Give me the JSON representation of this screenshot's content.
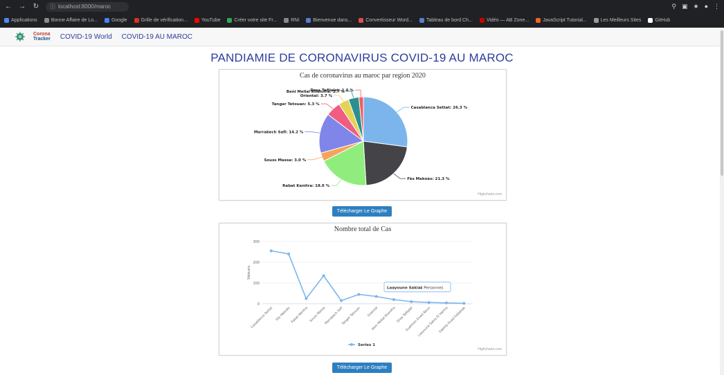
{
  "browser": {
    "url": "localhost:8000/maroc",
    "bookmarks": [
      {
        "label": "Applications",
        "color": "#4c8bf5"
      },
      {
        "label": "Bonne Affaire de Lo...",
        "color": "#8a8a8a"
      },
      {
        "label": "Google",
        "color": "#4285f4"
      },
      {
        "label": "Grille de vérification...",
        "color": "#d93025"
      },
      {
        "label": "YouTube",
        "color": "#ff0000"
      },
      {
        "label": "Créer votre site Fr...",
        "color": "#34a853"
      },
      {
        "label": "RNI",
        "color": "#888888"
      },
      {
        "label": "Bienvenue dans...",
        "color": "#5b7cd1"
      },
      {
        "label": "Convertisseur Word...",
        "color": "#e34c4c"
      },
      {
        "label": "Tableau de bord Ch...",
        "color": "#5b7cd1"
      },
      {
        "label": "Vidéo — AB Zone...",
        "color": "#cc0000"
      },
      {
        "label": "JavaScript Tutorial...",
        "color": "#f06529"
      },
      {
        "label": "Les Meilleurs Sites",
        "color": "#999999"
      },
      {
        "label": "GitHub",
        "color": "#ffffff"
      }
    ]
  },
  "nav": {
    "logo_line1": "Corona",
    "logo_line2": "Tracker",
    "links": [
      "COVID-19 World",
      "COVID-19 AU MAROC"
    ]
  },
  "page": {
    "title": "PANDIAMIE DE CORONAVIRUS COVID-19 AU MAROC",
    "download_label": "Télécharger Le Graphe"
  },
  "colors": {
    "title": "#2b3c9c",
    "button": "#2d7fc0",
    "line": "#7cb5ec"
  },
  "chart_data": [
    {
      "type": "pie",
      "title": "Cas de coronavirus au maroc par region 2020",
      "credits": "Highcharts.com",
      "slices": [
        {
          "label": "Casablanca Settat",
          "value": 26.3,
          "color": "#7cb5ec"
        },
        {
          "label": "Fès Meknès",
          "value": 21.3,
          "color": "#434348"
        },
        {
          "label": "Rabat Kenitra",
          "value": 18.0,
          "color": "#90ed7d"
        },
        {
          "label": "Souss Massa",
          "value": 3.0,
          "color": "#f7a35c"
        },
        {
          "label": "Marrakech Safi",
          "value": 14.2,
          "color": "#8085e9"
        },
        {
          "label": "Tanger Tetouan",
          "value": 5.3,
          "color": "#f15c80"
        },
        {
          "label": "Oriental",
          "value": 3.7,
          "color": "#e4d354"
        },
        {
          "label": "Beni Mellal Khenifra",
          "value": 3.7,
          "color": "#2b908f"
        },
        {
          "label": "Draa Tafilalet",
          "value": 1.6,
          "color": "#f45b5b"
        }
      ]
    },
    {
      "type": "line",
      "title": "Nombre total de Cas",
      "ylabel": "Valeurs",
      "ylim": [
        0,
        300
      ],
      "yticks": [
        0,
        100,
        200,
        300
      ],
      "categories": [
        "Casablanca Settat",
        "Fès Meknès",
        "Rabat Kenitra",
        "Souss Massa",
        "Marrakech Safi",
        "Tanger Tetouan",
        "Oriental",
        "Beni Mellal Khenifra",
        "Draa Tafilalet",
        "Guelmim Oued Noun",
        "Laayoune Sakia El Hamra",
        "Dakhla Oued Eddahab"
      ],
      "series": [
        {
          "name": "Series 1",
          "values": [
            255,
            240,
            25,
            135,
            15,
            45,
            35,
            20,
            10,
            6,
            4,
            2
          ]
        }
      ],
      "tooltip": {
        "label": "Laayoune Sakia",
        "value": "4 Personnes"
      },
      "credits": "Highcharts.com"
    }
  ]
}
